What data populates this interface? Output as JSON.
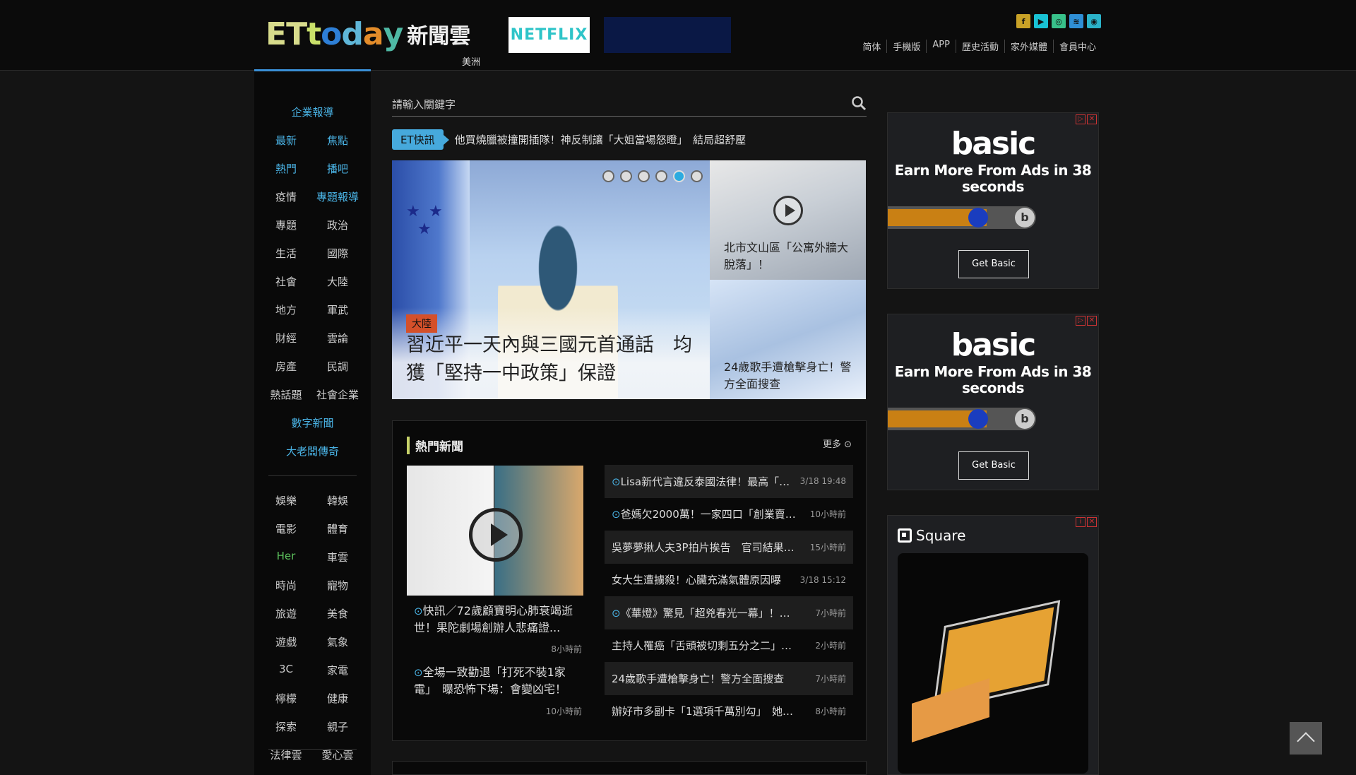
{
  "header": {
    "logo_text": "ETtoday",
    "logo_cn": "新聞雲",
    "region": "美洲",
    "ad_netflix": "NETFLIX",
    "social_icons": [
      "facebook-icon",
      "youtube-icon",
      "instagram-icon",
      "rss-icon",
      "weibo-icon"
    ],
    "nav": [
      "简体",
      "手機版",
      "APP",
      "歷史活動",
      "家外媒體",
      "會員中心"
    ]
  },
  "sidebar": {
    "top": [
      "企業報導"
    ],
    "pairs": [
      [
        "最新",
        "焦點"
      ],
      [
        "熱門",
        "播吧"
      ],
      [
        "疫情",
        "專題報導"
      ],
      [
        "專題",
        "政治"
      ],
      [
        "生活",
        "國際"
      ],
      [
        "社會",
        "大陸"
      ],
      [
        "地方",
        "軍武"
      ],
      [
        "財經",
        "雲論"
      ],
      [
        "房產",
        "民調"
      ],
      [
        "熱話題",
        "社會企業"
      ]
    ],
    "singles": [
      "數字新聞",
      "大老闆傳奇"
    ],
    "pairs2": [
      [
        "娛樂",
        "韓娛"
      ],
      [
        "電影",
        "體育"
      ],
      [
        "Her",
        "車雲"
      ],
      [
        "時尚",
        "寵物"
      ],
      [
        "旅遊",
        "美食"
      ],
      [
        "遊戲",
        "氣象"
      ],
      [
        "3C",
        "家電"
      ],
      [
        "檸檬",
        "健康"
      ],
      [
        "探索",
        "親子"
      ],
      [
        "法律雲",
        "愛心雲"
      ]
    ]
  },
  "search": {
    "placeholder": "請輸入關鍵字"
  },
  "flash": {
    "tag": "ET快訊",
    "text": "他買燒臘被撞開插隊！神反制讓「大姐當場怒瞪」　結局超舒壓"
  },
  "hero": {
    "category": "大陸",
    "title": "習近平一天內與三國元首通話　均獲「堅持一中政策」保證",
    "dots_total": 6,
    "dot_active": 5,
    "side1": "北市文山區「公寓外牆大脫落」！",
    "side2": "24歲歌手遭槍擊身亡！警方全面搜查"
  },
  "hot": {
    "title": "熱門新聞",
    "more": "更多",
    "left": [
      {
        "text": "快訊／72歲顧寶明心肺衰竭逝世！果陀劇場創辦人悲痛證...",
        "time": "8小時前",
        "video": true
      },
      {
        "text": "全場一致勸退「打死不裝1家電」　曝恐怖下場：會變凶宅！",
        "time": "10小時前",
        "video": true
      }
    ],
    "list": [
      {
        "text": "Lisa新代言違反泰國法律！最高「…",
        "time": "3/18 19:48",
        "video": true
      },
      {
        "text": "爸媽欠2000萬！一家四口「創業賣…",
        "time": "10小時前",
        "video": true
      },
      {
        "text": "吳夢夢揪人夫3P拍片挨告　官司結果…",
        "time": "15小時前",
        "video": false
      },
      {
        "text": "女大生遭擄殺！心臟充滿氣體原因曝",
        "time": "3/18 15:12",
        "video": false
      },
      {
        "text": "《華燈》驚見「超兇春光一幕」！…",
        "time": "7小時前",
        "video": true
      },
      {
        "text": "主持人罹癌「舌頭被切剩五分之二」…",
        "time": "2小時前",
        "video": false
      },
      {
        "text": "24歲歌手遭槍擊身亡！警方全面搜查",
        "time": "7小時前",
        "video": false
      },
      {
        "text": "辦好市多副卡「1選項千萬別勾」　她…",
        "time": "8小時前",
        "video": false
      }
    ]
  },
  "ads": {
    "basic_brand": "basic",
    "basic_headline": "Earn More From Ads in 38 seconds",
    "basic_cta": "Get Basic",
    "square_brand": "Square"
  }
}
